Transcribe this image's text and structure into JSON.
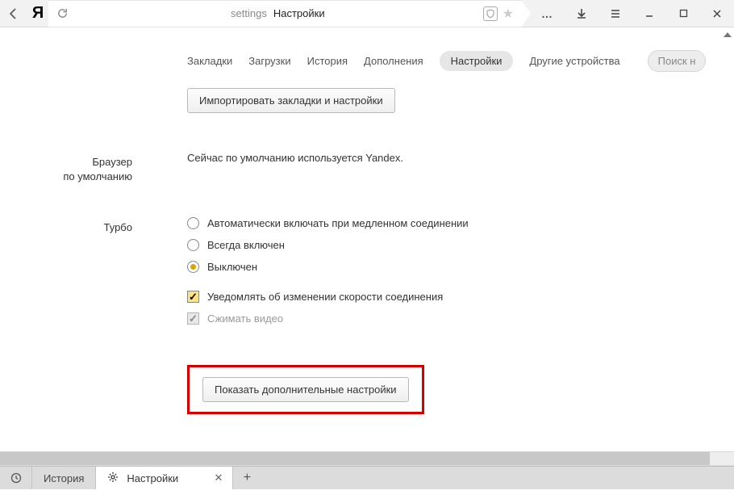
{
  "titlebar": {
    "url_key": "settings",
    "url_title": "Настройки"
  },
  "tabs": {
    "bookmarks": "Закладки",
    "downloads": "Загрузки",
    "history": "История",
    "addons": "Дополнения",
    "settings": "Настройки",
    "other_devices": "Другие устройства",
    "search_placeholder": "Поиск н"
  },
  "import": {
    "button": "Импортировать закладки и настройки"
  },
  "default_browser": {
    "label_line1": "Браузер",
    "label_line2": "по умолчанию",
    "text": "Сейчас по умолчанию используется Yandex."
  },
  "turbo": {
    "label": "Турбо",
    "opt_auto": "Автоматически включать при медленном соединении",
    "opt_always": "Всегда включен",
    "opt_off": "Выключен",
    "opt_notify": "Уведомлять об изменении скорости соединения",
    "opt_compress": "Сжимать видео",
    "selected": "off",
    "notify_checked": true,
    "compress_checked": true,
    "compress_disabled": true
  },
  "advanced": {
    "button": "Показать дополнительные настройки"
  },
  "tabstrip": {
    "background_tab": "История",
    "active_tab": "Настройки"
  }
}
